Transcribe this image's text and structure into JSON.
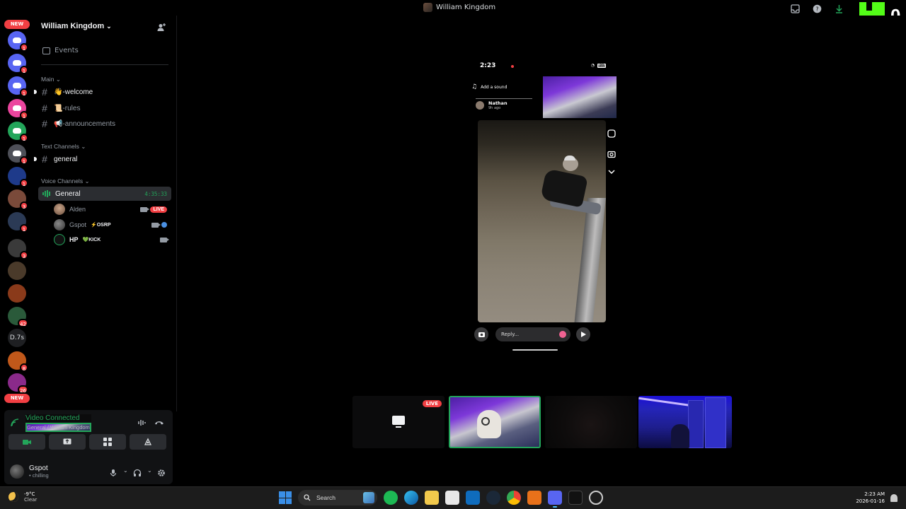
{
  "window": {
    "title": "William Kingdom",
    "kick_counter": "0"
  },
  "rail": {
    "new_label_top": "NEW",
    "new_label_bottom": "NEW",
    "text_server": "D.7s",
    "servers": [
      {
        "color": "#5865f2",
        "badge": "1"
      },
      {
        "color": "#5865f2",
        "badge": "1"
      },
      {
        "color": "#5865f2",
        "badge": "1"
      },
      {
        "color": "#eb459e",
        "badge": "1"
      },
      {
        "color": "#23a55a",
        "badge": "1"
      },
      {
        "color": "#4e5058",
        "badge": "1"
      },
      {
        "color": "#1e3a8a",
        "badge": "1"
      },
      {
        "color": "#7a4a3a",
        "badge": "3"
      },
      {
        "color": "#2b3a55",
        "badge": "1"
      },
      {
        "color": "#3a3a3a",
        "badge": "3"
      },
      {
        "color": "#4a3a2a",
        "badge": ""
      },
      {
        "color": "#8a3a1a",
        "badge": ""
      },
      {
        "color": "#2a5a3a",
        "badge": "42"
      },
      {
        "color": "#c0581a",
        "badge": "8"
      },
      {
        "color": "#8a2a8a",
        "badge": "26"
      }
    ]
  },
  "sidebar": {
    "server_name": "William Kingdom",
    "events": "Events",
    "cat_main": "Main",
    "ch_welcome": "👋-welcome",
    "ch_rules": "📜-rules",
    "ch_announcements": "📢-announcements",
    "cat_text": "Text Channels",
    "ch_general": "general",
    "cat_voice": "Voice Channels",
    "voice_channel": "General",
    "voice_timer": "4:35:33",
    "users": [
      {
        "name": "Alden",
        "tag": "",
        "live": "LIVE"
      },
      {
        "name": "Gspot",
        "tag": "⚡OSRP",
        "live": ""
      },
      {
        "name": "HP",
        "tag": "💚KICK",
        "live": ""
      }
    ]
  },
  "panel": {
    "status": "Video Connected",
    "location": "General / William Kingdom",
    "user_name": "Gspot",
    "user_status": "• chilling"
  },
  "stream": {
    "phone": {
      "time": "2:23",
      "battery": "20",
      "sound": "Add a sound",
      "poster": "Nathan",
      "posted": "9h ago",
      "reply_placeholder": "Reply..."
    },
    "tiles": [
      {
        "label": "LIVE"
      }
    ]
  },
  "taskbar": {
    "temp": "-9°C",
    "condition": "Clear",
    "search": "Search",
    "time": "2:23 AM",
    "date": "2026-01-16"
  },
  "colors": {
    "accent_green": "#23a55a",
    "live_red": "#f23f43",
    "kick_green": "#53fc18"
  }
}
